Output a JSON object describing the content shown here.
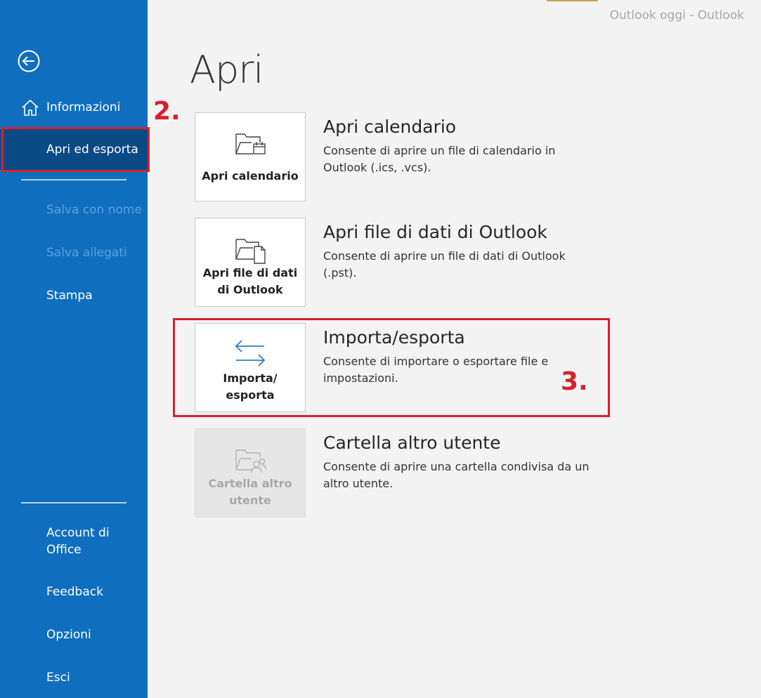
{
  "window": {
    "title": "Outlook oggi  -  Outlook"
  },
  "sidebar": {
    "items": {
      "informazioni": "Informazioni",
      "apri": "Apri ed esporta",
      "salva": "Salva con nome",
      "allegati": "Salva allegati",
      "stampa": "Stampa",
      "account": "Account di Office",
      "feedback": "Feedback",
      "opzioni": "Opzioni",
      "esci": "Esci"
    }
  },
  "annotations": {
    "step2": "2.",
    "step3": "3."
  },
  "main": {
    "title": "Apri",
    "options": [
      {
        "tile": "Apri calendario",
        "title": "Apri calendario",
        "desc": "Consente di aprire un file di calendario in Outlook (.ics, .vcs).",
        "icon": "calendar-folder-icon"
      },
      {
        "tile": "Apri file di dati di Outlook",
        "title": "Apri file di dati di Outlook",
        "desc": "Consente di aprire un file di dati di Outlook (.pst).",
        "icon": "data-file-folder-icon"
      },
      {
        "tile": "Importa/ esporta",
        "title": "Importa/esporta",
        "desc": "Consente di importare o esportare file e impostazioni.",
        "icon": "import-export-arrows-icon"
      },
      {
        "tile": "Cartella altro utente",
        "title": "Cartella altro utente",
        "desc": "Consente di aprire una cartella condivisa da un altro utente.",
        "icon": "shared-user-folder-icon"
      }
    ]
  },
  "colors": {
    "sidebar": "#106ebe",
    "selected": "#0a4a85",
    "annotation": "#d9202e",
    "accent": "#2e7cc4"
  }
}
